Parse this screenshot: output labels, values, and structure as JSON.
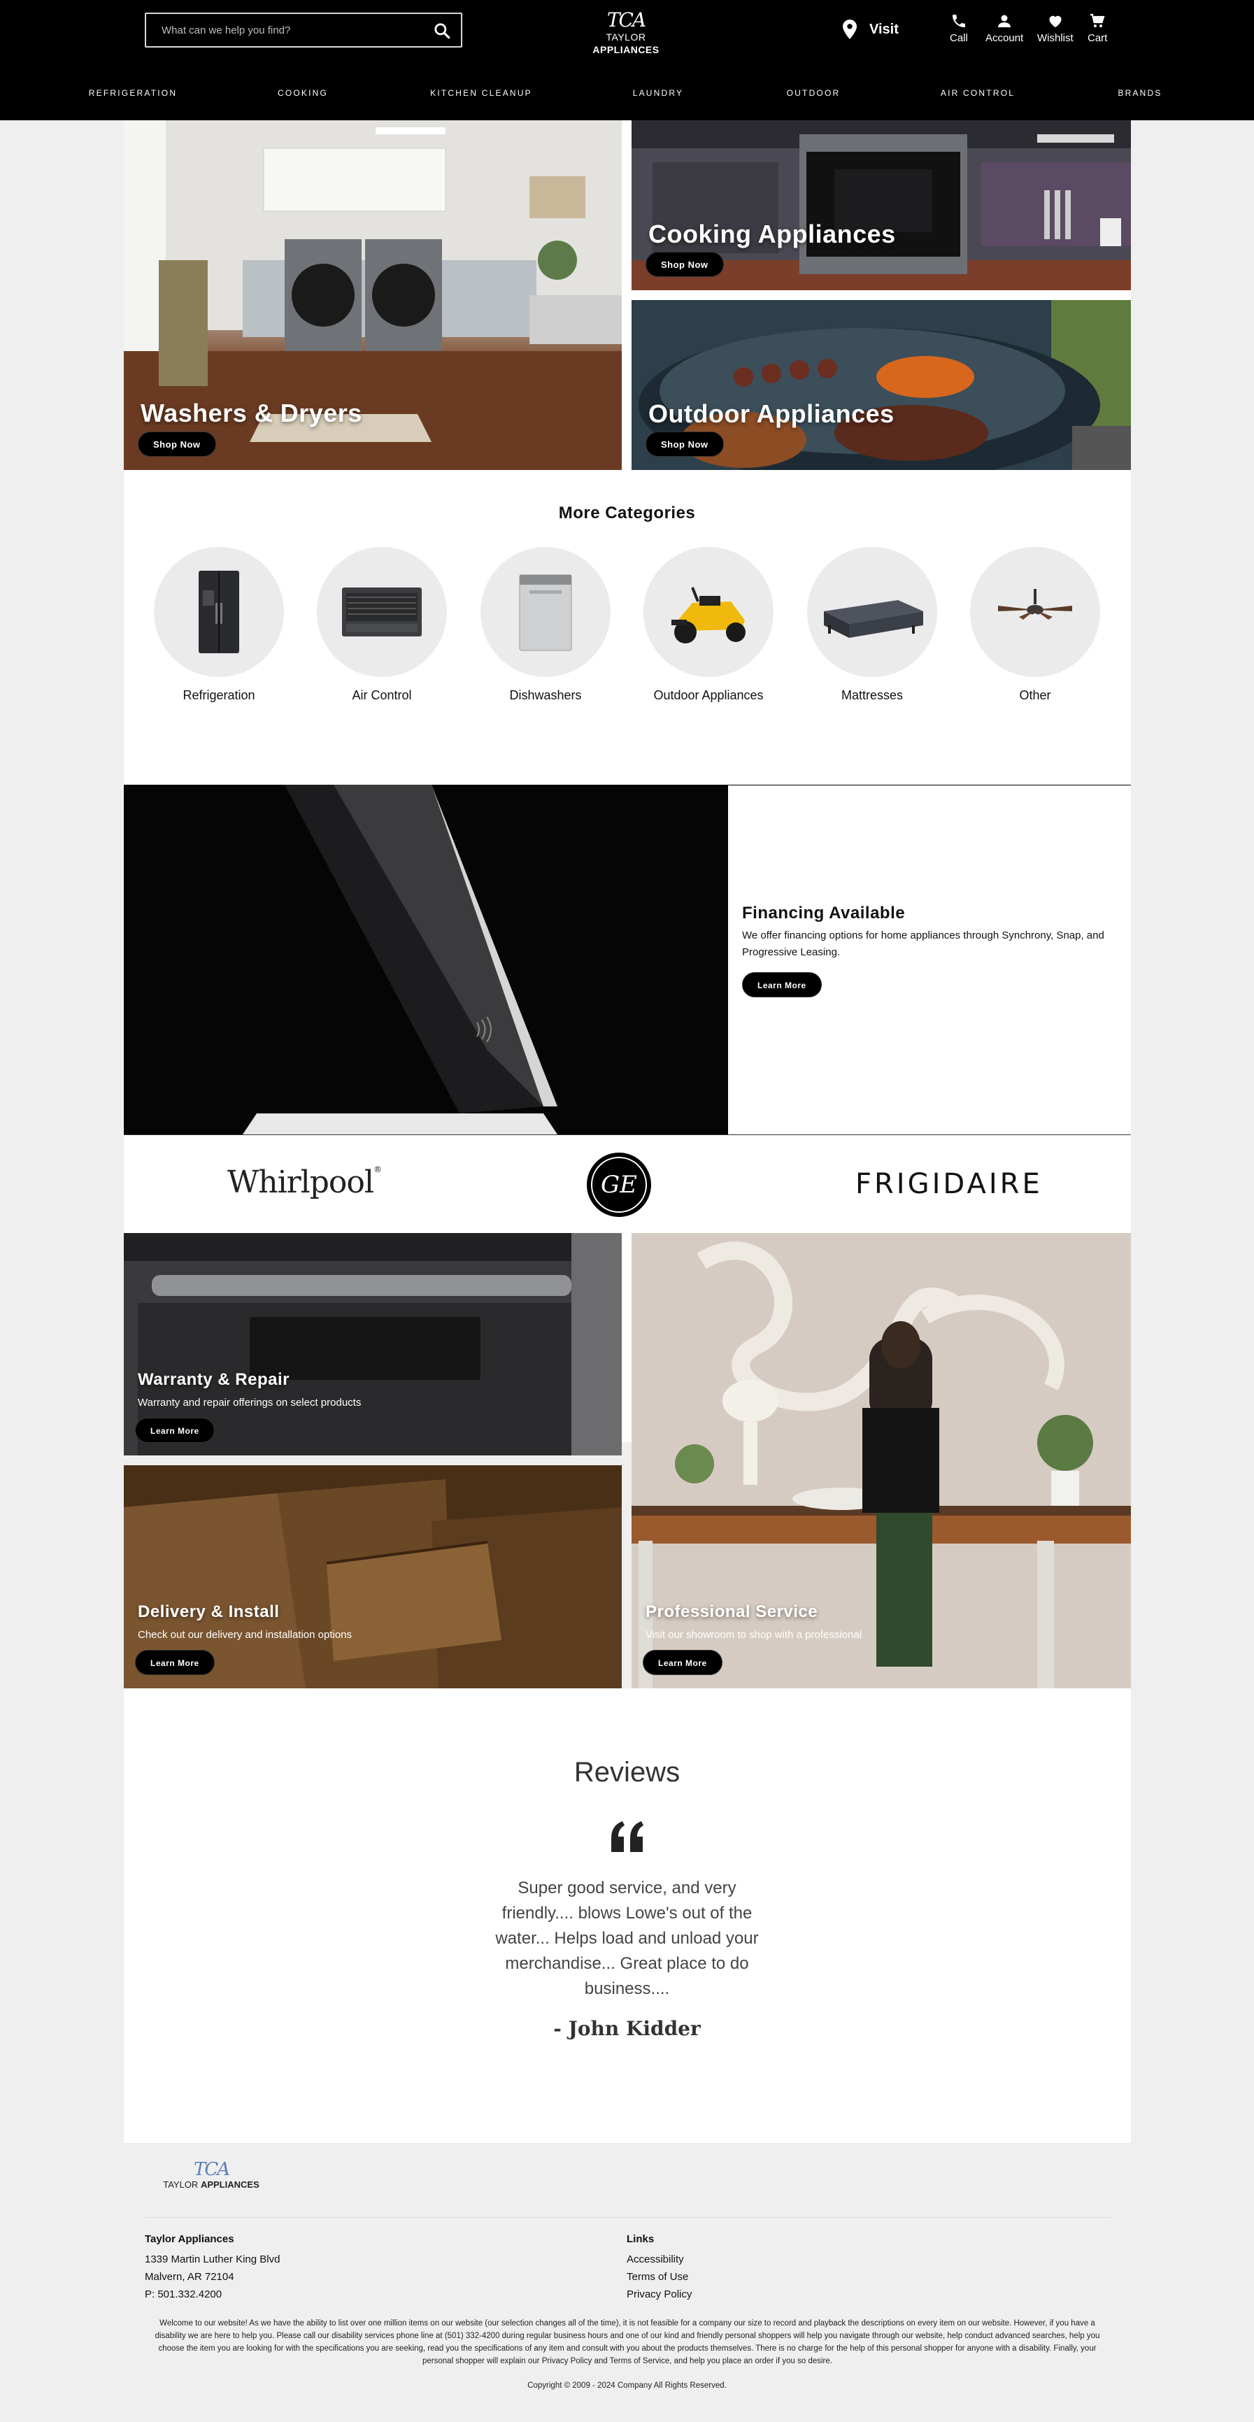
{
  "header": {
    "search_placeholder": "What can we help you find?",
    "logo_monogram": "TCA",
    "logo_name_light": "TAYLOR",
    "logo_name_bold": "APPLIANCES",
    "visit_label": "Visit",
    "icons": [
      {
        "label": "Call",
        "icon": "phone-icon"
      },
      {
        "label": "Account",
        "icon": "user-icon"
      },
      {
        "label": "Wishlist",
        "icon": "heart-icon"
      },
      {
        "label": "Cart",
        "icon": "cart-icon"
      }
    ]
  },
  "nav": [
    "REFRIGERATION",
    "COOKING",
    "KITCHEN CLEANUP",
    "LAUNDRY",
    "OUTDOOR",
    "AIR CONTROL",
    "BRANDS"
  ],
  "hero": {
    "washers": {
      "title": "Washers & Dryers",
      "button": "Shop Now"
    },
    "cooking": {
      "title": "Cooking Appliances",
      "button": "Shop Now"
    },
    "outdoor": {
      "title": "Outdoor Appliances",
      "button": "Shop Now"
    }
  },
  "categories": {
    "title": "More Categories",
    "items": [
      "Refrigeration",
      "Air Control",
      "Dishwashers",
      "Outdoor Appliances",
      "Mattresses",
      "Other"
    ]
  },
  "financing": {
    "title": "Financing Available",
    "text": "We offer financing options for home appliances through Synchrony, Snap, and Progressive Leasing.",
    "button": "Learn More"
  },
  "brands": {
    "whirlpool": "Whirlpool",
    "ge": "GE",
    "frigidaire": "FRIGIDAIRE"
  },
  "services": {
    "warranty": {
      "title": "Warranty & Repair",
      "text": "Warranty and repair offerings on select products",
      "button": "Learn More"
    },
    "delivery": {
      "title": "Delivery & Install",
      "text": "Check out our delivery and installation options",
      "button": "Learn More"
    },
    "professional": {
      "title": "Professional Service",
      "text": "Visit our showroom to shop with a professional",
      "button": "Learn More"
    }
  },
  "reviews": {
    "title": "Reviews",
    "quote": "Super good service, and very friendly.... blows Lowe's out of the water... Helps load and unload your merchandise... Great place to do business....",
    "author": "- John Kidder"
  },
  "footer": {
    "company": "Taylor Appliances",
    "address1": "1339 Martin Luther King Blvd",
    "address2": "Malvern, AR 72104",
    "phone": "P: 501.332.4200",
    "links_title": "Links",
    "links": [
      "Accessibility",
      "Terms of Use",
      "Privacy Policy"
    ],
    "disclaimer": "Welcome to our website! As we have the ability to list over one million items on our website (our selection changes all of the time), it is not feasible for a company our size to record and playback the descriptions on every item on our website. However, if you have a disability we are here to help you. Please call our disability services phone line at (501) 332-4200 during regular business hours and one of our kind and friendly personal shoppers will help you navigate through our website, help conduct advanced searches, help you choose the item you are looking for with the specifications you are seeking, read you the specifications of any item and consult with you about the products themselves. There is no charge for the help of this personal shopper for anyone with a disability. Finally, your personal shopper will explain our Privacy Policy and Terms of Service, and help you place an order if you so desire.",
    "copyright": "Copyright © 2009 - 2024 Company All Rights Reserved."
  },
  "colors": {
    "header_bg": "#000000",
    "page_bg": "#efefef",
    "button_bg": "#000000",
    "accent_logo": "#5b7fb8"
  }
}
